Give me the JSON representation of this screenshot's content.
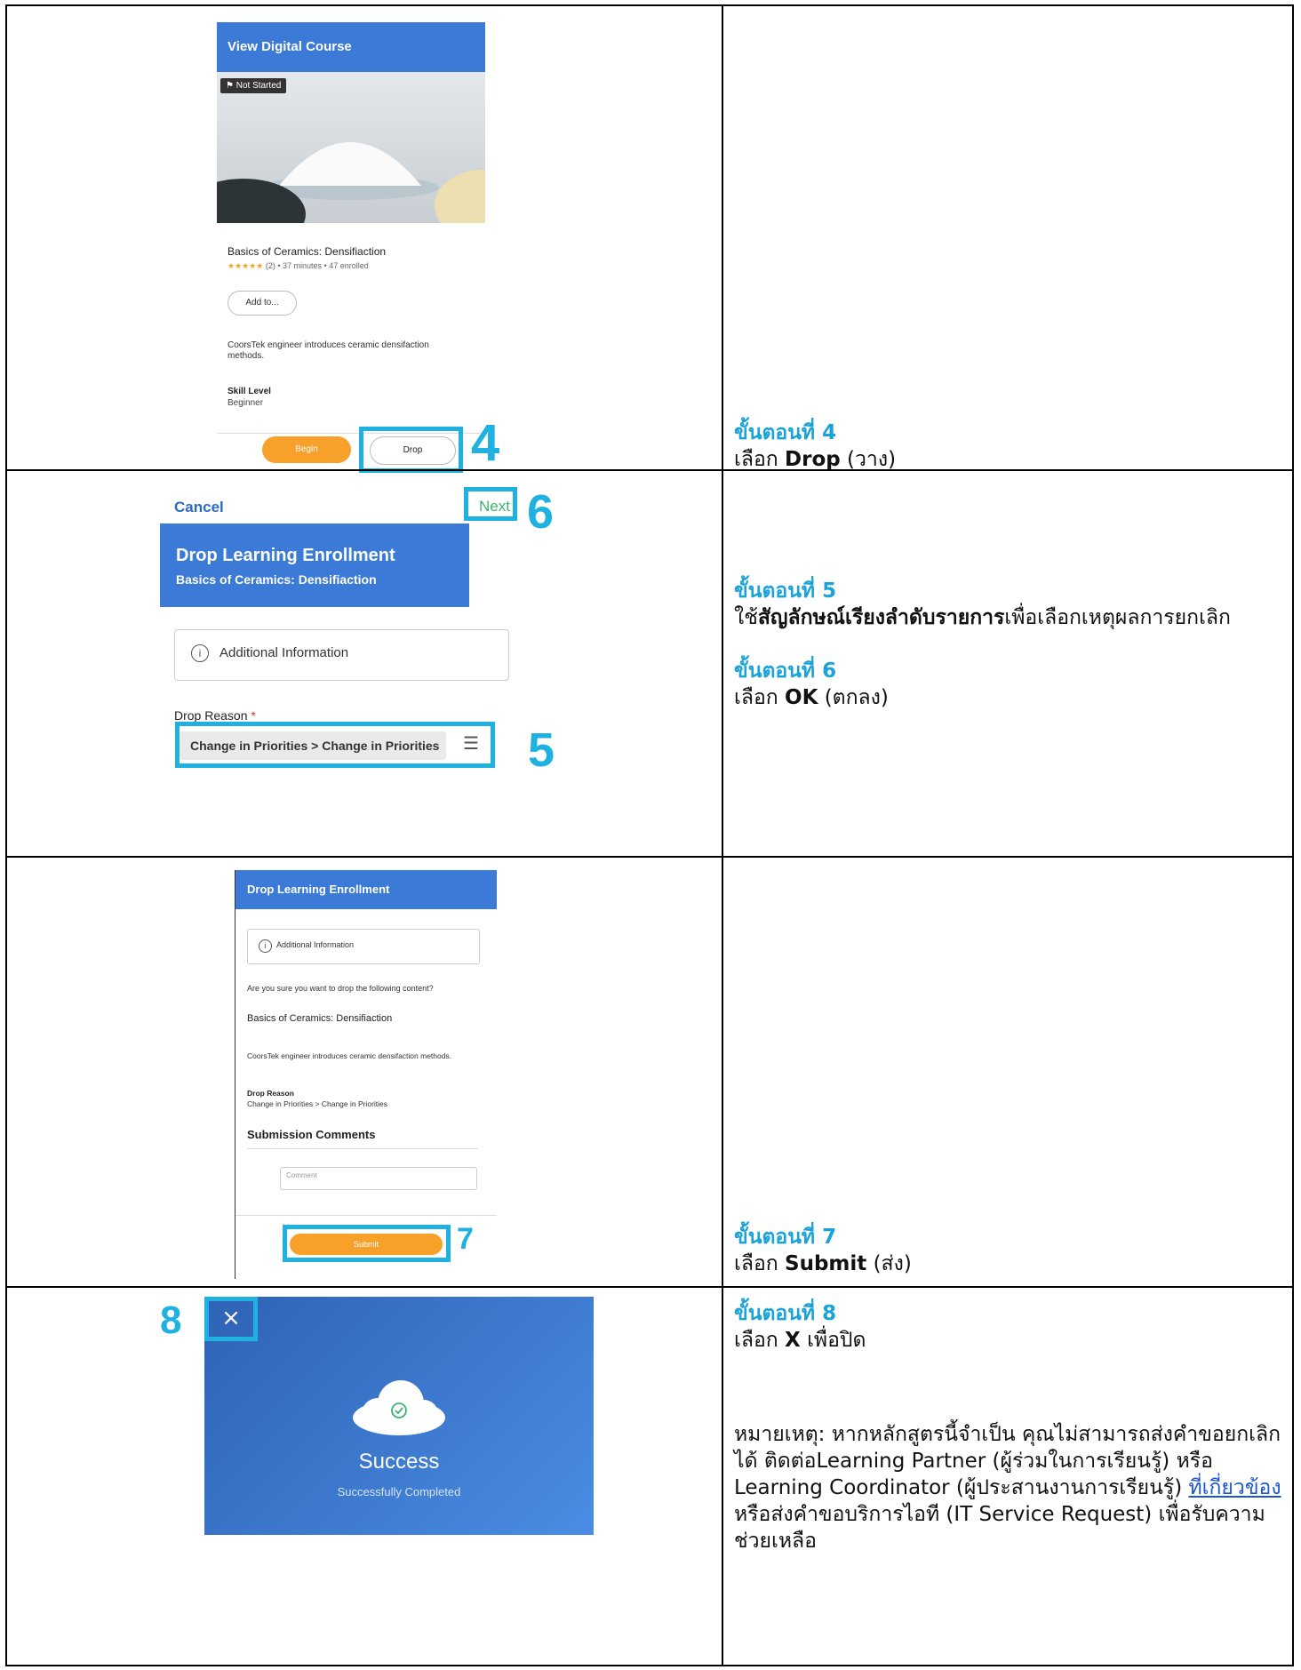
{
  "row1": {
    "screen_title": "View Digital Course",
    "status_badge": "Not Started",
    "course_title": "Basics of Ceramics: Densifiaction",
    "stars": "★★★★★",
    "rating_count": "(2)",
    "duration": "37 minutes",
    "enrolled": "47 enrolled",
    "add_to_label": "Add to...",
    "description": "CoorsTek engineer introduces ceramic densifaction methods.",
    "skill_level_label": "Skill Level",
    "skill_level_value": "Beginner",
    "begin_label": "Begin",
    "drop_label": "Drop",
    "callout": "4",
    "step_title": "ขั้นตอนที่ 4",
    "step_prefix": "เลือก",
    "step_bold": "Drop",
    "step_suffix": "(วาง)"
  },
  "row2": {
    "cancel_label": "Cancel",
    "next_label": "Next",
    "callout_next": "6",
    "header_title": "Drop Learning Enrollment",
    "header_subtitle": "Basics of Ceramics: Densifiaction",
    "info_label": "Additional Information",
    "drop_reason_label": "Drop Reason",
    "required_mark": "*",
    "drop_reason_value": "Change in Priorities > Change in Priorities",
    "callout_reason": "5",
    "step5_title": "ขั้นตอนที่ 5",
    "step5_prefix": "ใช้",
    "step5_bold": "สัญลักษณ์เรียงลำดับรายการ",
    "step5_suffix": "เพื่อเลือกเหตุผลการยกเลิก",
    "step6_title": "ขั้นตอนที่ 6",
    "step6_prefix": "เลือก",
    "step6_bold": "OK",
    "step6_suffix": "(ตกลง)"
  },
  "row3": {
    "header_title": "Drop Learning Enrollment",
    "info_label": "Additional Information",
    "confirm_question": "Are you sure you want to drop the following content?",
    "course_title": "Basics of Ceramics: Densifiaction",
    "description": "CoorsTek engineer introduces ceramic densifaction methods.",
    "drop_reason_label": "Drop Reason",
    "drop_reason_value": "Change in Priorities > Change in Priorities",
    "comments_heading": "Submission Comments",
    "comment_placeholder": "Comment",
    "submit_label": "Submit",
    "callout": "7",
    "step_title": "ขั้นตอนที่ 7",
    "step_prefix": "เลือก",
    "step_bold": "Submit",
    "step_suffix": "(ส่ง)"
  },
  "row4": {
    "close_glyph": "×",
    "callout": "8",
    "success_title": "Success",
    "success_subtitle": "Successfully Completed",
    "step_title": "ขั้นตอนที่ 8",
    "step_prefix": "เลือก",
    "step_bold": "X",
    "step_suffix": "เพื่อปิด",
    "note_text": "หมายเหตุ: หากหลักสูตรนี้จำเป็น คุณไม่สามารถส่งคำขอยกเลิกได้ ติดต่อLearning Partner (ผู้ร่วมในการเรียนรู้) หรือ Learning Coordinator (ผู้ประสานงานการเรียนรู้)",
    "note_link": "ที่เกี่ยวข้อง",
    "note_tail": "หรือส่งคำขอบริการไอที (IT Service Request) เพื่อรับความช่วยเหลือ"
  },
  "colors": {
    "accent": "#1fb1e0",
    "step_title": "#1aa3d9",
    "workday_blue": "#3b7ad6",
    "orange": "#f7a12b"
  }
}
